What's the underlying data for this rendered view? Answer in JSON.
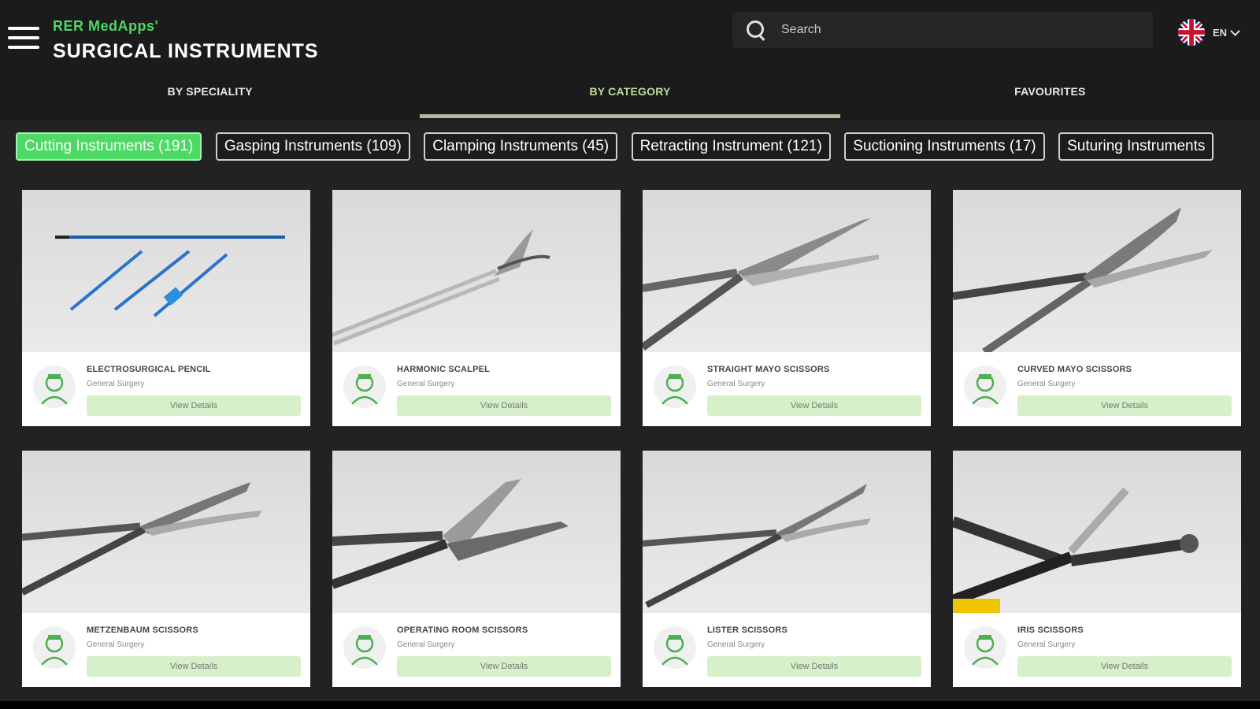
{
  "header": {
    "brand_sub": "RER MedApps'",
    "brand_title": "SURGICAL INSTRUMENTS",
    "search_placeholder": "Search",
    "lang_code": "EN"
  },
  "tabs": [
    {
      "label": "BY SPECIALITY",
      "active": false
    },
    {
      "label": "BY CATEGORY",
      "active": true
    },
    {
      "label": "FAVOURITES",
      "active": false
    }
  ],
  "chips": [
    {
      "label": "Cutting Instruments (191)",
      "active": true
    },
    {
      "label": "Gasping Instruments (109)",
      "active": false
    },
    {
      "label": "Clamping Instruments (45)",
      "active": false
    },
    {
      "label": "Retracting Instrument (121)",
      "active": false
    },
    {
      "label": "Suctioning Instruments (17)",
      "active": false
    },
    {
      "label": "Suturing Instruments",
      "active": false
    }
  ],
  "cards": [
    {
      "title": "ELECTROSURGICAL PENCIL",
      "subtitle": "General Surgery",
      "button": "View Details",
      "image_icon": "electrosurgical-pencil-icon"
    },
    {
      "title": "HARMONIC SCALPEL",
      "subtitle": "General Surgery",
      "button": "View Details",
      "image_icon": "harmonic-scalpel-icon"
    },
    {
      "title": "STRAIGHT MAYO SCISSORS",
      "subtitle": "General Surgery",
      "button": "View Details",
      "image_icon": "scissors-icon"
    },
    {
      "title": "CURVED MAYO SCISSORS",
      "subtitle": "General Surgery",
      "button": "View Details",
      "image_icon": "scissors-icon"
    },
    {
      "title": "METZENBAUM SCISSORS",
      "subtitle": "General Surgery",
      "button": "View Details",
      "image_icon": "scissors-icon"
    },
    {
      "title": "OPERATING ROOM SCISSORS",
      "subtitle": "General Surgery",
      "button": "View Details",
      "image_icon": "scissors-icon"
    },
    {
      "title": "LISTER SCISSORS",
      "subtitle": "General Surgery",
      "button": "View Details",
      "image_icon": "scissors-icon"
    },
    {
      "title": "IRIS SCISSORS",
      "subtitle": "General Surgery",
      "button": "View Details",
      "image_icon": "scissors-icon"
    }
  ],
  "colors": {
    "accent_green": "#4cd964",
    "active_tab_text": "#c2dc9b",
    "button_bg": "#d6f0c9",
    "header_bg": "#1b1b1b"
  }
}
